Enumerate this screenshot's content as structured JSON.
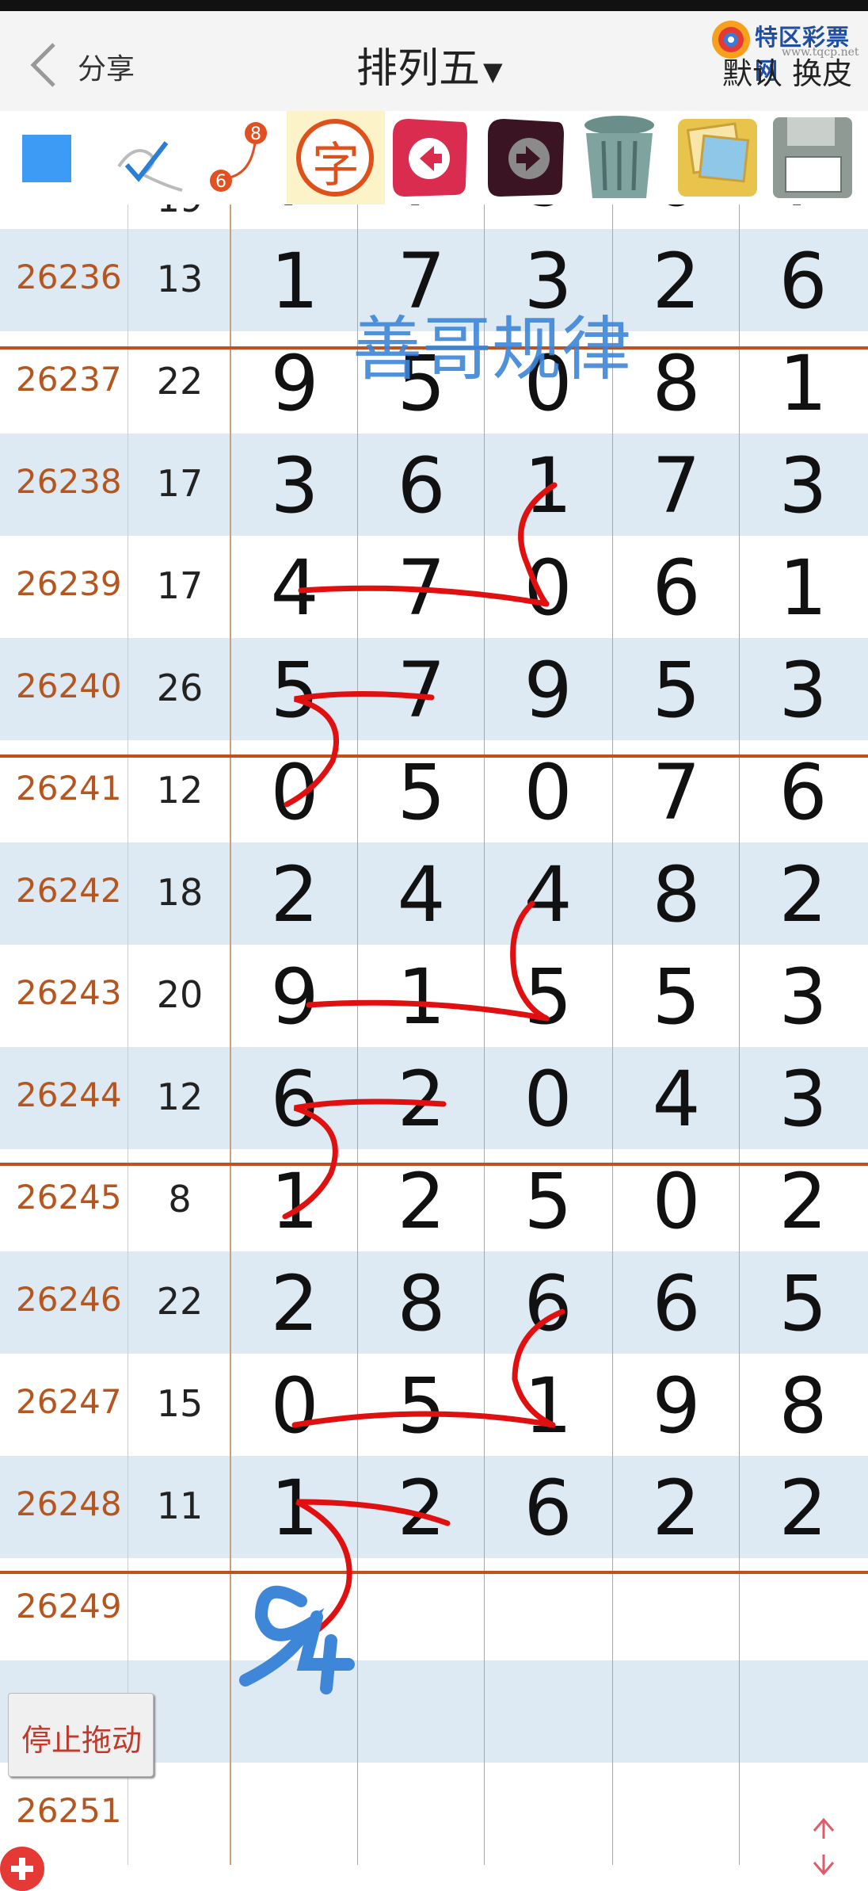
{
  "header": {
    "share_label": "分享",
    "title": "排列五",
    "skin_label": "默认 换皮",
    "logo_text": "特区彩票网",
    "logo_sub": "www.tqcp.net"
  },
  "toolbar": {
    "icons": [
      "color-square-icon",
      "pen-icon",
      "sequence-icon",
      "text-icon",
      "back-arrow-icon",
      "forward-arrow-icon",
      "trash-icon",
      "image-icon",
      "save-disk-icon"
    ],
    "text_icon_label": "字",
    "sequence_icon_digits": [
      "6",
      "8"
    ]
  },
  "watermark": "善哥规律",
  "handwriting": "94",
  "rows": [
    {
      "id": "26236",
      "sum": "13",
      "d": [
        "1",
        "7",
        "3",
        "2",
        "6"
      ]
    },
    {
      "id": "26237",
      "sum": "22",
      "d": [
        "9",
        "5",
        "0",
        "8",
        "1"
      ]
    },
    {
      "id": "26238",
      "sum": "17",
      "d": [
        "3",
        "6",
        "1",
        "7",
        "3"
      ]
    },
    {
      "id": "26239",
      "sum": "17",
      "d": [
        "4",
        "7",
        "0",
        "6",
        "1"
      ]
    },
    {
      "id": "26240",
      "sum": "26",
      "d": [
        "5",
        "7",
        "9",
        "5",
        "3"
      ]
    },
    {
      "id": "26241",
      "sum": "12",
      "d": [
        "0",
        "5",
        "0",
        "7",
        "6"
      ]
    },
    {
      "id": "26242",
      "sum": "18",
      "d": [
        "2",
        "4",
        "4",
        "8",
        "2"
      ]
    },
    {
      "id": "26243",
      "sum": "20",
      "d": [
        "9",
        "1",
        "5",
        "5",
        "3"
      ]
    },
    {
      "id": "26244",
      "sum": "12",
      "d": [
        "6",
        "2",
        "0",
        "4",
        "3"
      ]
    },
    {
      "id": "26245",
      "sum": "8",
      "d": [
        "1",
        "2",
        "5",
        "0",
        "2"
      ]
    },
    {
      "id": "26246",
      "sum": "22",
      "d": [
        "2",
        "8",
        "6",
        "6",
        "5"
      ]
    },
    {
      "id": "26247",
      "sum": "15",
      "d": [
        "0",
        "5",
        "1",
        "9",
        "8"
      ]
    },
    {
      "id": "26248",
      "sum": "11",
      "d": [
        "1",
        "2",
        "6",
        "2",
        "2"
      ]
    },
    {
      "id": "26249",
      "sum": "",
      "d": [
        "",
        "",
        "",
        "",
        ""
      ]
    },
    {
      "id": "",
      "sum": "",
      "d": [
        "",
        "",
        "",
        "",
        ""
      ]
    },
    {
      "id": "26251",
      "sum": "",
      "d": [
        "",
        "",
        "",
        "",
        ""
      ]
    }
  ],
  "buttons": {
    "stop_drag": "停止拖动"
  },
  "colors": {
    "row_shade": "#dde9f3",
    "separator": "#c0501e",
    "id_text": "#b5551f",
    "pen_red": "#e01010",
    "pen_blue": "#3d86d8"
  }
}
